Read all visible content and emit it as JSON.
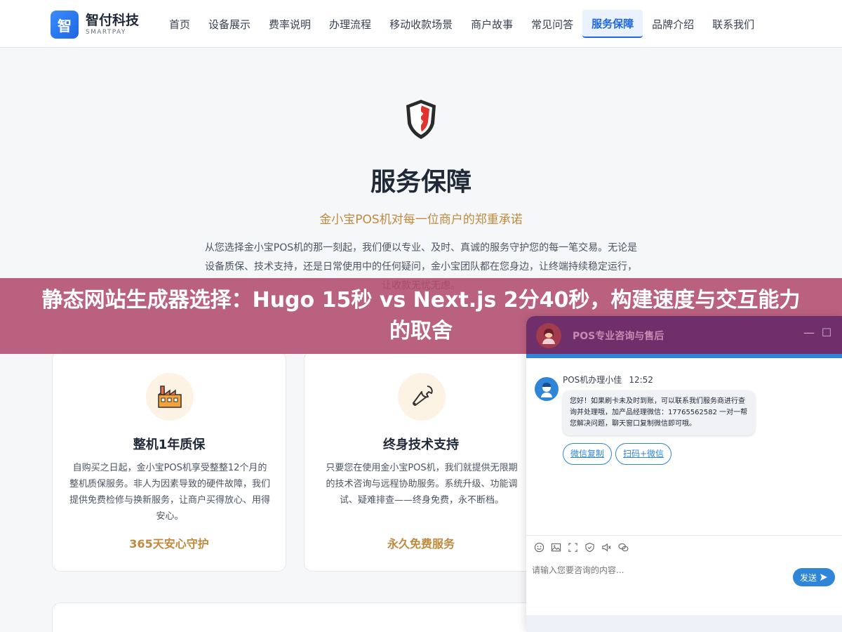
{
  "header": {
    "logo_mark": "智",
    "logo_name": "智付科技",
    "logo_sub": "SMARTPAY",
    "nav": [
      {
        "label": "首页"
      },
      {
        "label": "设备展示"
      },
      {
        "label": "费率说明"
      },
      {
        "label": "办理流程"
      },
      {
        "label": "移动收款场景"
      },
      {
        "label": "商户故事"
      },
      {
        "label": "常见问答"
      },
      {
        "label": "服务保障",
        "active": true
      },
      {
        "label": "品牌介绍"
      },
      {
        "label": "联系我们"
      }
    ]
  },
  "hero": {
    "icon": "shield-icon",
    "title": "服务保障",
    "subtitle": "金小宝POS机对每一位商户的郑重承诺",
    "description": "从您选择金小宝POS机的那一刻起，我们便以专业、及时、真诚的服务守护您的每一笔交易。无论是设备质保、技术支持，还是日常使用中的任何疑问，金小宝团队都在您身边，让终端持续稳定运行，让收款无忧无虑。"
  },
  "banner": {
    "text": "静态网站生成器选择：Hugo 15秒 vs Next.js 2分40秒，构建速度与交互能力的取舍"
  },
  "cards": [
    {
      "icon": "factory-icon",
      "title": "整机1年质保",
      "description": "自购买之日起，金小宝POS机享受整整12个月的整机质保服务。非人为因素导致的硬件故障，我们提供免费检修与换新服务，让商户买得放心、用得安心。",
      "tag": "365天安心守护"
    },
    {
      "icon": "wrench-icon",
      "title": "终身技术支持",
      "description": "只要您在使用金小宝POS机，我们就提供无限期的技术咨询与远程协助服务。系统升级、功能调试、疑难排查——终身免费，永不断档。",
      "tag": "永久免费服务"
    }
  ],
  "chat": {
    "header_title": "POS专业咨询与售后",
    "minimize_icon": "minimize-icon",
    "maximize_icon": "maximize-icon",
    "agent_name": "POS机办理小佳",
    "time": "12:52",
    "message": "您好！如果刷卡未及时到账，可以联系我们服务商进行查询并处理哦，加产品经理微信：17765562582 一对一帮您解决问题，聊天窗口复制微信即可哦。",
    "quick_replies": [
      "微信复制",
      "扫码+微信"
    ],
    "toolbar_icons": [
      "emoji-icon",
      "image-icon",
      "screenshot-icon",
      "evaluate-icon",
      "sound-icon",
      "wechat-icon"
    ],
    "input_placeholder": "请输入您要咨询的内容...",
    "send_label": "发送",
    "colors": {
      "header": "#6f2f6a",
      "accent": "#2f86d8"
    }
  },
  "colors": {
    "brand_blue": "#1f66e0",
    "gold": "#c08a3e",
    "banner": "#b34c6e"
  }
}
